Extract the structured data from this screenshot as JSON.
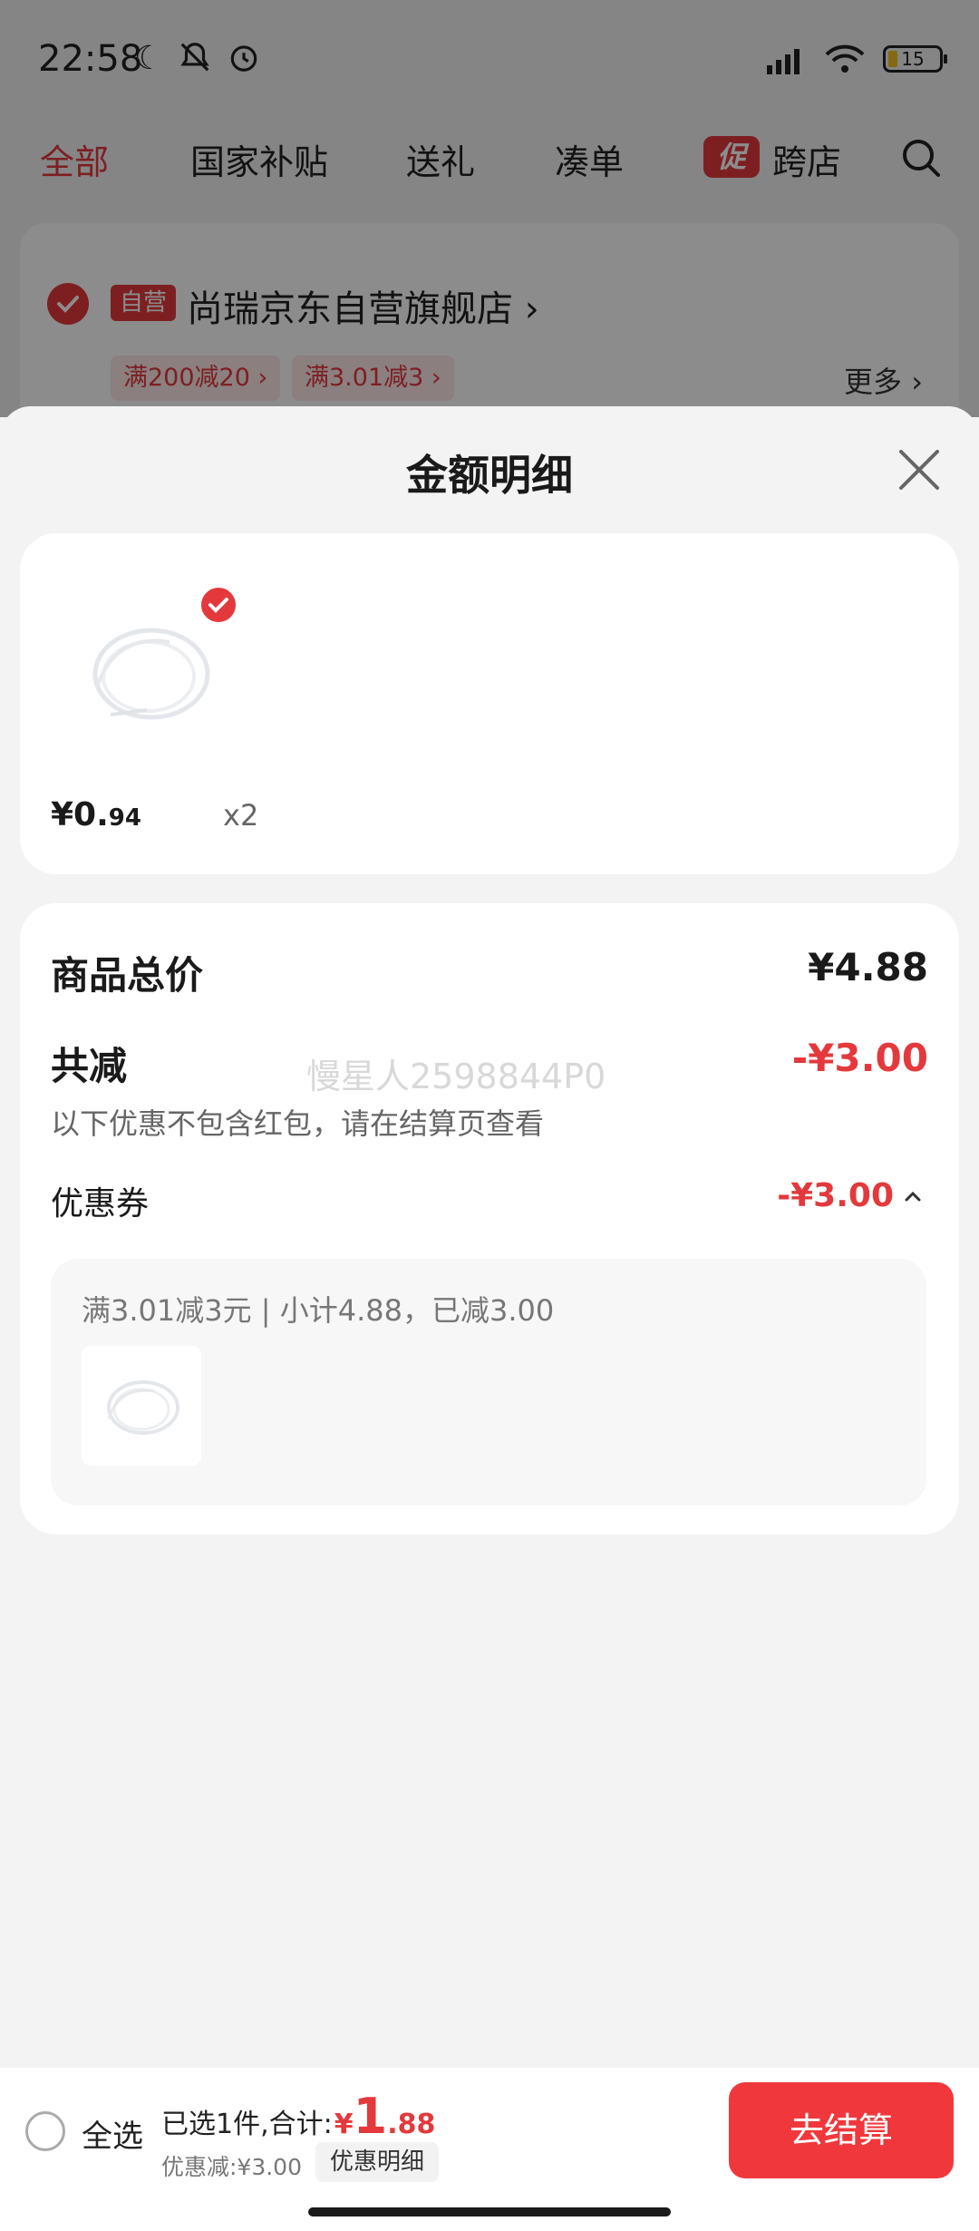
{
  "status_bar": {
    "time": "22:58",
    "battery": "15"
  },
  "category_tabs": {
    "items": [
      "全部",
      "国家补贴",
      "送礼",
      "凑单"
    ],
    "promo_badge": "促",
    "cross_store": "跨店"
  },
  "store": {
    "self_tag": "自营",
    "name": "尚瑞京东自营旗舰店 ›",
    "coupons": [
      "满200减20 ›",
      "满3.01减3 ›"
    ],
    "more": "更多 ›"
  },
  "sheet": {
    "title": "金额明细",
    "product": {
      "price_main": "¥0.",
      "price_decimal": "94",
      "quantity": "x2"
    },
    "summary": {
      "total_label": "商品总价",
      "total_value": "¥4.88",
      "reduce_label": "共减",
      "reduce_value": "-¥3.00",
      "watermark": "慢星人2598844P0",
      "note": "以下优惠不包含红包，请在结算页查看",
      "coupon_label": "优惠券",
      "coupon_value": "-¥3.00",
      "coupon_desc": "满3.01减3元 | 小计4.88，已减3.00"
    }
  },
  "checkout": {
    "select_all": "全选",
    "total_prefix": "已选1件,合计:",
    "total_currency": "¥",
    "total_integer": "1",
    "total_decimal": ".88",
    "discount": "优惠减:¥3.00",
    "detail_button": "优惠明细",
    "checkout_button": "去结算"
  },
  "colors": {
    "accent": "#e4393c",
    "checkout_button": "#f0383c"
  }
}
